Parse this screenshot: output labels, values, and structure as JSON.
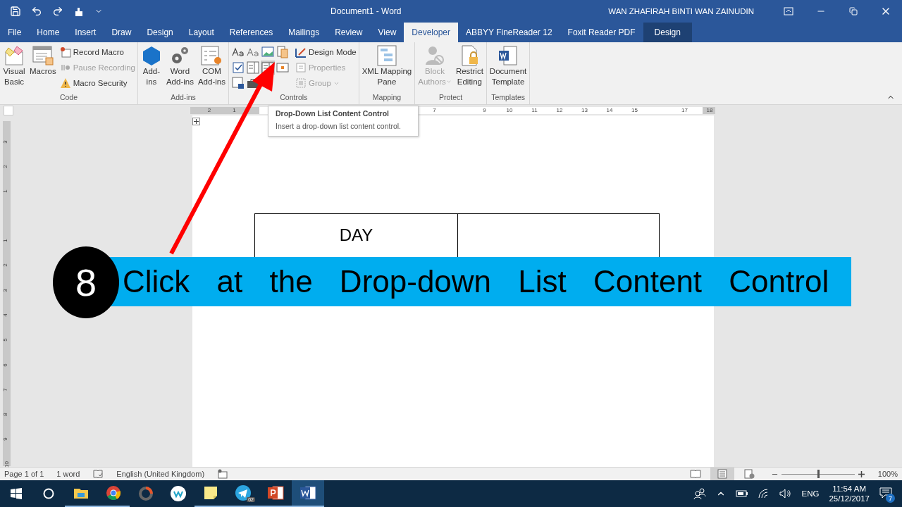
{
  "title_bar": {
    "title": "Document1  -  Word",
    "user": "WAN ZHAFIRAH BINTI WAN ZAINUDIN"
  },
  "tabs": [
    {
      "label": "File",
      "kind": "normal",
      "selected": false
    },
    {
      "label": "Home",
      "kind": "normal",
      "selected": false
    },
    {
      "label": "Insert",
      "kind": "normal",
      "selected": false
    },
    {
      "label": "Draw",
      "kind": "normal",
      "selected": false
    },
    {
      "label": "Design",
      "kind": "normal",
      "selected": false
    },
    {
      "label": "Layout",
      "kind": "normal",
      "selected": false
    },
    {
      "label": "References",
      "kind": "normal",
      "selected": false
    },
    {
      "label": "Mailings",
      "kind": "normal",
      "selected": false
    },
    {
      "label": "Review",
      "kind": "normal",
      "selected": false
    },
    {
      "label": "View",
      "kind": "normal",
      "selected": false
    },
    {
      "label": "Developer",
      "kind": "normal",
      "selected": true
    },
    {
      "label": "ABBYY FineReader 12",
      "kind": "normal",
      "selected": false
    },
    {
      "label": "Foxit Reader PDF",
      "kind": "normal",
      "selected": false
    },
    {
      "label": "Design",
      "kind": "contextual",
      "selected": false
    }
  ],
  "ribbon": [
    {
      "name": "Code",
      "items": [
        {
          "kind": "large",
          "lines": [
            "Visual",
            "Basic"
          ],
          "disabled": false
        },
        {
          "kind": "large",
          "lines": [
            "Macros"
          ],
          "disabled": false
        },
        {
          "kind": "stack",
          "buttons": [
            {
              "label": "Record Macro",
              "disabled": false
            },
            {
              "label": "Pause Recording",
              "disabled": true
            },
            {
              "label": "Macro Security",
              "disabled": false
            }
          ]
        }
      ]
    },
    {
      "name": "Add-ins",
      "items": [
        {
          "kind": "large",
          "lines": [
            "Add-",
            "ins"
          ],
          "disabled": false
        },
        {
          "kind": "large",
          "lines": [
            "Word",
            "Add-ins"
          ],
          "disabled": false
        },
        {
          "kind": "large",
          "lines": [
            "COM",
            "Add-ins"
          ],
          "disabled": false
        }
      ]
    },
    {
      "name": "Controls",
      "items": [
        {
          "kind": "grid",
          "icons": [
            {
              "hovered": false
            },
            {
              "hovered": false
            },
            {
              "hovered": false
            },
            {
              "hovered": false
            },
            {
              "hovered": false
            },
            {
              "hovered": false
            },
            {
              "hovered": true
            },
            {
              "hovered": false
            },
            {
              "hovered": false
            },
            {
              "hovered": false
            }
          ]
        },
        {
          "kind": "stack",
          "buttons": [
            {
              "label": "Design Mode",
              "disabled": false
            },
            {
              "label": "Properties",
              "disabled": true
            },
            {
              "label": "Group",
              "disabled": true,
              "caret": true
            }
          ]
        }
      ]
    },
    {
      "name": "Mapping",
      "items": [
        {
          "kind": "large",
          "lines": [
            "XML Mapping",
            "Pane"
          ],
          "disabled": false
        }
      ]
    },
    {
      "name": "Protect",
      "items": [
        {
          "kind": "large",
          "lines": [
            "Block",
            "Authors"
          ],
          "disabled": true,
          "caret": true
        },
        {
          "kind": "large",
          "lines": [
            "Restrict",
            "Editing"
          ],
          "disabled": false
        }
      ]
    },
    {
      "name": "Templates",
      "items": [
        {
          "kind": "large",
          "lines": [
            "Document",
            "Template"
          ],
          "disabled": false
        }
      ]
    }
  ],
  "ruler": {
    "left_labels": [
      "2",
      "1"
    ],
    "right_labels": [
      "7",
      "9",
      "10",
      "11",
      "12",
      "13",
      "14",
      "15",
      "17",
      "18"
    ]
  },
  "vertical_ruler": {
    "above": [
      "3",
      "2",
      "1"
    ],
    "below": [
      "1",
      "2",
      "3",
      "4",
      "5",
      "6",
      "7",
      "8",
      "9",
      "10"
    ]
  },
  "tooltip": {
    "title": "Drop-Down List Content Control",
    "body": "Insert a drop-down list content control."
  },
  "document": {
    "table": {
      "rows": [
        [
          "DAY",
          ""
        ]
      ]
    }
  },
  "step": {
    "number": "8",
    "text": "Click at the Drop-down List Content Control"
  },
  "status_bar": {
    "page": "Page 1 of 1",
    "words": "1 word",
    "language": "English (United Kingdom)",
    "views": [
      {
        "kind": "read",
        "selected": false
      },
      {
        "kind": "print",
        "selected": true
      },
      {
        "kind": "web",
        "selected": false
      }
    ],
    "zoom": {
      "level": 0.5,
      "reading": "100%"
    }
  },
  "taskbar": {
    "apps": [
      {
        "kind": "explorer",
        "running": true,
        "selected": false
      },
      {
        "kind": "chrome",
        "running": true,
        "selected": false
      },
      {
        "kind": "ring",
        "running": false,
        "selected": false
      },
      {
        "kind": "w-circle",
        "running": false,
        "selected": false
      },
      {
        "kind": "notes",
        "running": true,
        "selected": false
      },
      {
        "kind": "telegram",
        "running": true,
        "selected": false,
        "badge": "02"
      },
      {
        "kind": "powerpoint",
        "running": true,
        "selected": false
      },
      {
        "kind": "word",
        "running": true,
        "selected": true
      }
    ],
    "language": "ENG",
    "time": "11:54 AM",
    "date": "25/12/2017",
    "notifications": "7"
  }
}
